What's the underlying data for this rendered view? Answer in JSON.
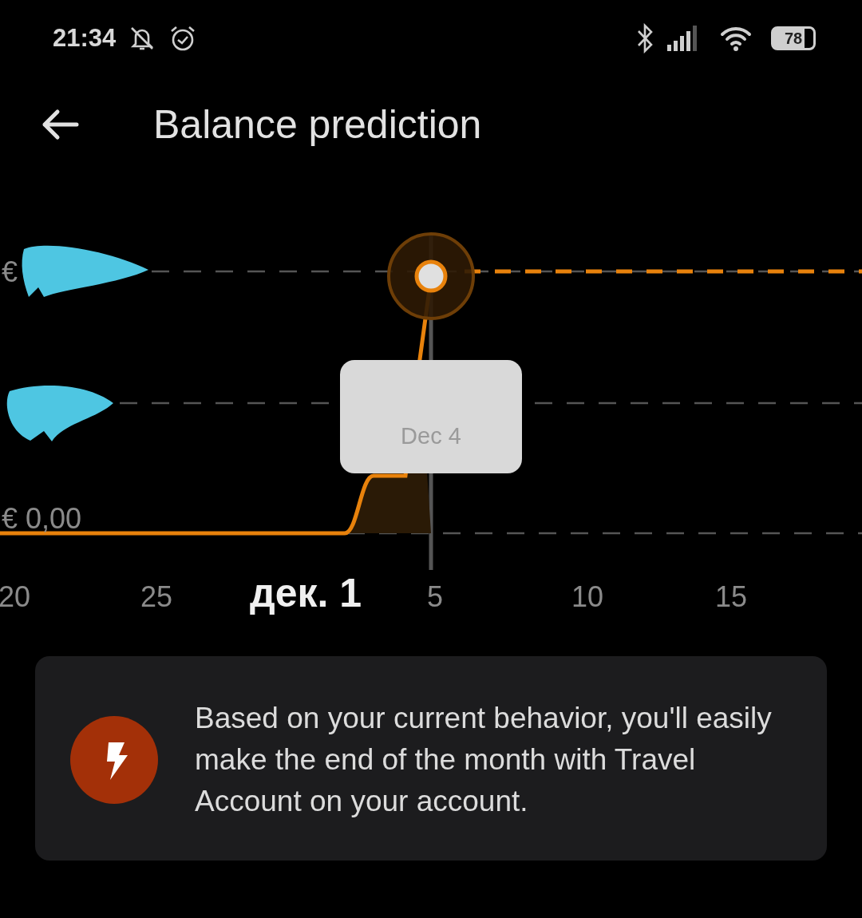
{
  "status_bar": {
    "time": "21:34",
    "battery": "78"
  },
  "header": {
    "title": "Balance prediction"
  },
  "chart": {
    "y_labels": {
      "top": "€",
      "bottom": "€ 0,00"
    },
    "x_labels": [
      {
        "text": "20",
        "kind": "normal"
      },
      {
        "text": "25",
        "kind": "normal"
      },
      {
        "text": "дек. 1",
        "kind": "month"
      },
      {
        "text": "5",
        "kind": "normal"
      },
      {
        "text": "10",
        "kind": "normal"
      },
      {
        "text": "15",
        "kind": "normal"
      }
    ],
    "tooltip": {
      "date": "Dec 4"
    }
  },
  "insight": {
    "message": "Based on your current behavior, you'll easily make the end of the month with Travel Account on your account."
  }
}
